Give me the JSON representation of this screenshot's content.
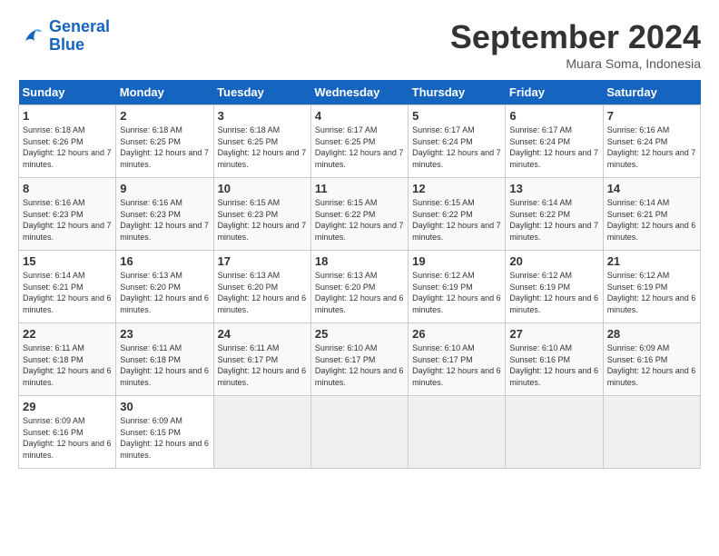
{
  "header": {
    "logo_line1": "General",
    "logo_line2": "Blue",
    "month": "September 2024",
    "location": "Muara Soma, Indonesia"
  },
  "weekdays": [
    "Sunday",
    "Monday",
    "Tuesday",
    "Wednesday",
    "Thursday",
    "Friday",
    "Saturday"
  ],
  "weeks": [
    [
      {
        "day": "1",
        "sunrise": "6:18 AM",
        "sunset": "6:26 PM",
        "daylight": "12 hours and 7 minutes."
      },
      {
        "day": "2",
        "sunrise": "6:18 AM",
        "sunset": "6:25 PM",
        "daylight": "12 hours and 7 minutes."
      },
      {
        "day": "3",
        "sunrise": "6:18 AM",
        "sunset": "6:25 PM",
        "daylight": "12 hours and 7 minutes."
      },
      {
        "day": "4",
        "sunrise": "6:17 AM",
        "sunset": "6:25 PM",
        "daylight": "12 hours and 7 minutes."
      },
      {
        "day": "5",
        "sunrise": "6:17 AM",
        "sunset": "6:24 PM",
        "daylight": "12 hours and 7 minutes."
      },
      {
        "day": "6",
        "sunrise": "6:17 AM",
        "sunset": "6:24 PM",
        "daylight": "12 hours and 7 minutes."
      },
      {
        "day": "7",
        "sunrise": "6:16 AM",
        "sunset": "6:24 PM",
        "daylight": "12 hours and 7 minutes."
      }
    ],
    [
      {
        "day": "8",
        "sunrise": "6:16 AM",
        "sunset": "6:23 PM",
        "daylight": "12 hours and 7 minutes."
      },
      {
        "day": "9",
        "sunrise": "6:16 AM",
        "sunset": "6:23 PM",
        "daylight": "12 hours and 7 minutes."
      },
      {
        "day": "10",
        "sunrise": "6:15 AM",
        "sunset": "6:23 PM",
        "daylight": "12 hours and 7 minutes."
      },
      {
        "day": "11",
        "sunrise": "6:15 AM",
        "sunset": "6:22 PM",
        "daylight": "12 hours and 7 minutes."
      },
      {
        "day": "12",
        "sunrise": "6:15 AM",
        "sunset": "6:22 PM",
        "daylight": "12 hours and 7 minutes."
      },
      {
        "day": "13",
        "sunrise": "6:14 AM",
        "sunset": "6:22 PM",
        "daylight": "12 hours and 7 minutes."
      },
      {
        "day": "14",
        "sunrise": "6:14 AM",
        "sunset": "6:21 PM",
        "daylight": "12 hours and 6 minutes."
      }
    ],
    [
      {
        "day": "15",
        "sunrise": "6:14 AM",
        "sunset": "6:21 PM",
        "daylight": "12 hours and 6 minutes."
      },
      {
        "day": "16",
        "sunrise": "6:13 AM",
        "sunset": "6:20 PM",
        "daylight": "12 hours and 6 minutes."
      },
      {
        "day": "17",
        "sunrise": "6:13 AM",
        "sunset": "6:20 PM",
        "daylight": "12 hours and 6 minutes."
      },
      {
        "day": "18",
        "sunrise": "6:13 AM",
        "sunset": "6:20 PM",
        "daylight": "12 hours and 6 minutes."
      },
      {
        "day": "19",
        "sunrise": "6:12 AM",
        "sunset": "6:19 PM",
        "daylight": "12 hours and 6 minutes."
      },
      {
        "day": "20",
        "sunrise": "6:12 AM",
        "sunset": "6:19 PM",
        "daylight": "12 hours and 6 minutes."
      },
      {
        "day": "21",
        "sunrise": "6:12 AM",
        "sunset": "6:19 PM",
        "daylight": "12 hours and 6 minutes."
      }
    ],
    [
      {
        "day": "22",
        "sunrise": "6:11 AM",
        "sunset": "6:18 PM",
        "daylight": "12 hours and 6 minutes."
      },
      {
        "day": "23",
        "sunrise": "6:11 AM",
        "sunset": "6:18 PM",
        "daylight": "12 hours and 6 minutes."
      },
      {
        "day": "24",
        "sunrise": "6:11 AM",
        "sunset": "6:17 PM",
        "daylight": "12 hours and 6 minutes."
      },
      {
        "day": "25",
        "sunrise": "6:10 AM",
        "sunset": "6:17 PM",
        "daylight": "12 hours and 6 minutes."
      },
      {
        "day": "26",
        "sunrise": "6:10 AM",
        "sunset": "6:17 PM",
        "daylight": "12 hours and 6 minutes."
      },
      {
        "day": "27",
        "sunrise": "6:10 AM",
        "sunset": "6:16 PM",
        "daylight": "12 hours and 6 minutes."
      },
      {
        "day": "28",
        "sunrise": "6:09 AM",
        "sunset": "6:16 PM",
        "daylight": "12 hours and 6 minutes."
      }
    ],
    [
      {
        "day": "29",
        "sunrise": "6:09 AM",
        "sunset": "6:16 PM",
        "daylight": "12 hours and 6 minutes."
      },
      {
        "day": "30",
        "sunrise": "6:09 AM",
        "sunset": "6:15 PM",
        "daylight": "12 hours and 6 minutes."
      },
      null,
      null,
      null,
      null,
      null
    ]
  ]
}
